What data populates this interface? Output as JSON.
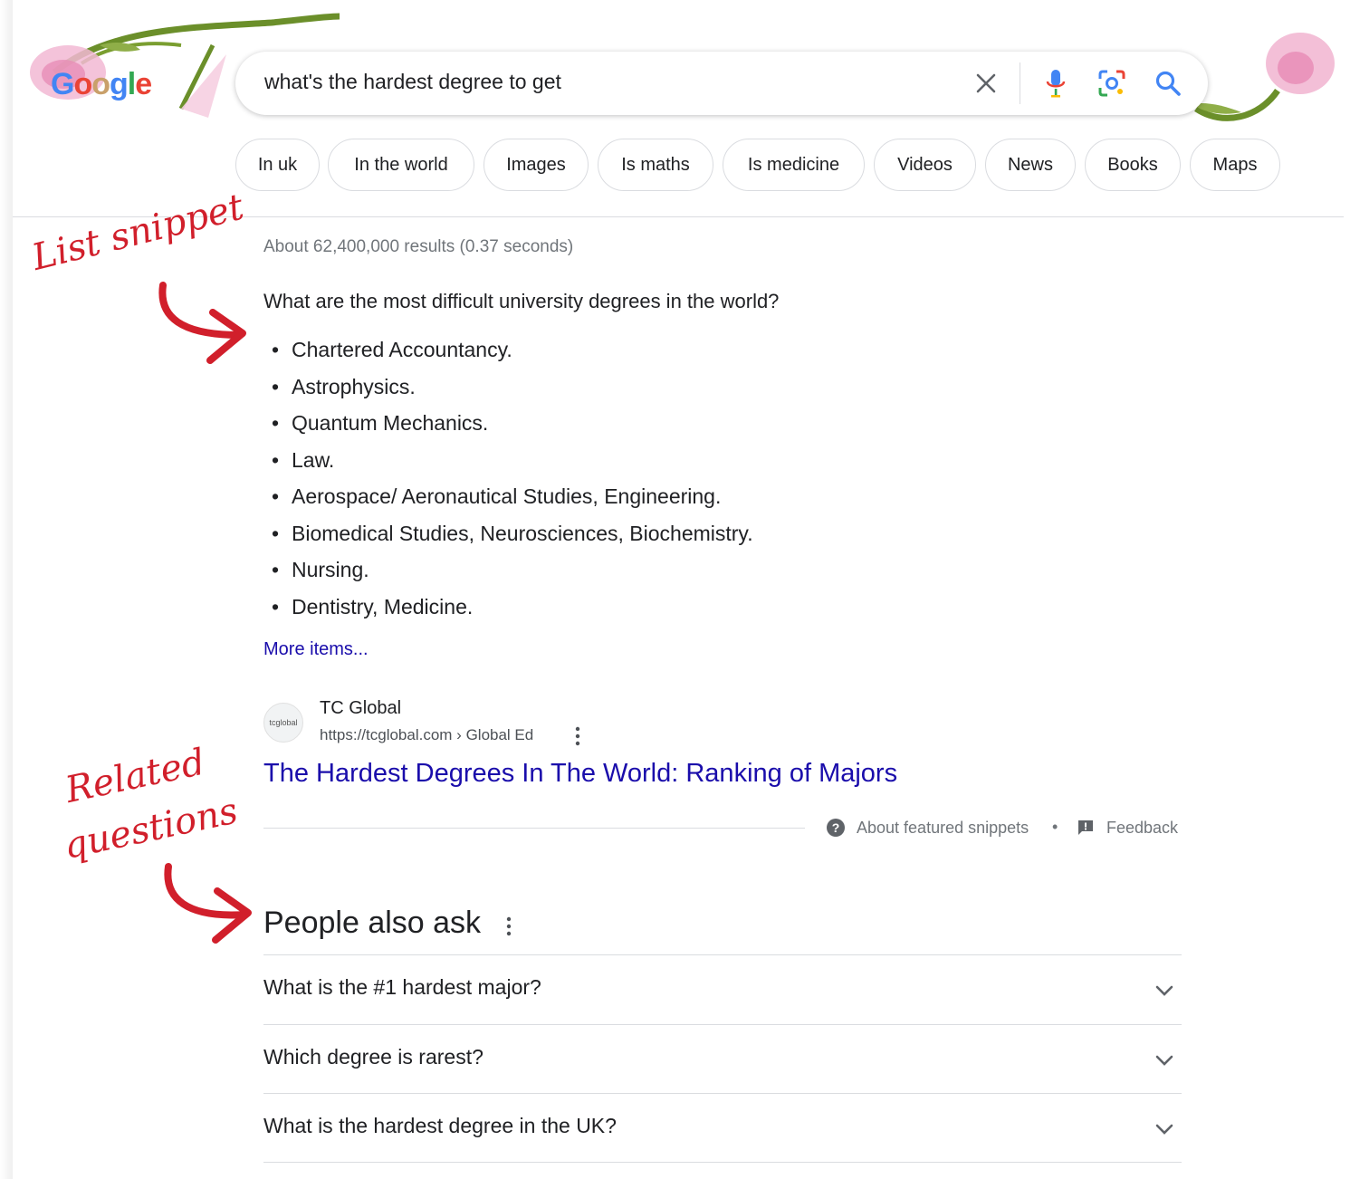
{
  "search": {
    "query": "what's the hardest degree to get"
  },
  "logo": {
    "text": "Google"
  },
  "chips": [
    "In uk",
    "In the world",
    "Images",
    "Is maths",
    "Is medicine",
    "Videos",
    "News",
    "Books",
    "Maps"
  ],
  "results": {
    "stats": "About 62,400,000 results (0.37 seconds)",
    "featured_snippet": {
      "question": "What are the most difficult university degrees in the world?",
      "items": [
        "Chartered Accountancy.",
        "Astrophysics.",
        "Quantum Mechanics.",
        "Law.",
        "Aerospace/ Aeronautical Studies, Engineering.",
        "Biomedical Studies, Neurosciences, Biochemistry.",
        "Nursing.",
        "Dentistry, Medicine."
      ],
      "more_items": "More items...",
      "source": {
        "name": "TC Global",
        "url": "https://tcglobal.com › Global Ed",
        "favicon_text": "tcglobal",
        "title": "The Hardest Degrees In The World: Ranking of Majors"
      },
      "about_label": "About featured snippets",
      "separator": "•",
      "feedback_label": "Feedback"
    },
    "people_also_ask": {
      "title": "People also ask",
      "questions": [
        "What is the #1 hardest major?",
        "Which degree is rarest?",
        "What is the hardest degree in the UK?"
      ]
    }
  },
  "annotations": {
    "list_snippet": "List snippet",
    "related_line1": "Related",
    "related_line2": "questions"
  },
  "colors": {
    "link_blue": "#1a0dab",
    "annotation_red": "#d11f2b",
    "mic_blue": "#4285f4",
    "search_blue": "#4285f4"
  }
}
